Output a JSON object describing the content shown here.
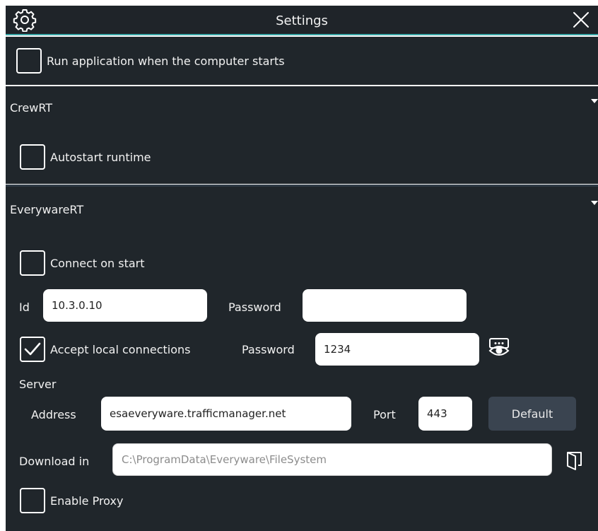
{
  "window": {
    "title": "Settings",
    "icons": {
      "settings": "gear-icon",
      "close": "close-icon"
    }
  },
  "startup": {
    "run_on_start_label": "Run application when the computer starts",
    "run_on_start_checked": false
  },
  "crewrt": {
    "title": "CrewRT",
    "autostart_label": "Autostart runtime",
    "autostart_checked": false
  },
  "everywarert": {
    "title": "EverywareRT",
    "connect_on_start_label": "Connect on start",
    "connect_on_start_checked": false,
    "id_label": "Id",
    "id_value": "10.3.0.10",
    "password_label": "Password",
    "password_value": "",
    "accept_local_label": "Accept local connections",
    "accept_local_checked": true,
    "local_password_label": "Password",
    "local_password_value": "1234",
    "server_label": "Server",
    "address_label": "Address",
    "address_value": "esaeveryware.trafficmanager.net",
    "port_label": "Port",
    "port_value": "443",
    "default_button_label": "Default",
    "download_in_label": "Download in",
    "download_in_placeholder": "C:\\ProgramData\\Everyware\\FileSystem",
    "enable_proxy_label": "Enable Proxy",
    "enable_proxy_checked": false,
    "icons": {
      "reveal_password": "eye-icon",
      "browse_folder": "folder-icon",
      "expand": "triangle-down-icon"
    }
  },
  "colors": {
    "background": "#20262b",
    "titlebar": "#1f2429",
    "accent": "#3aa6a6",
    "button": "#3a4450"
  }
}
